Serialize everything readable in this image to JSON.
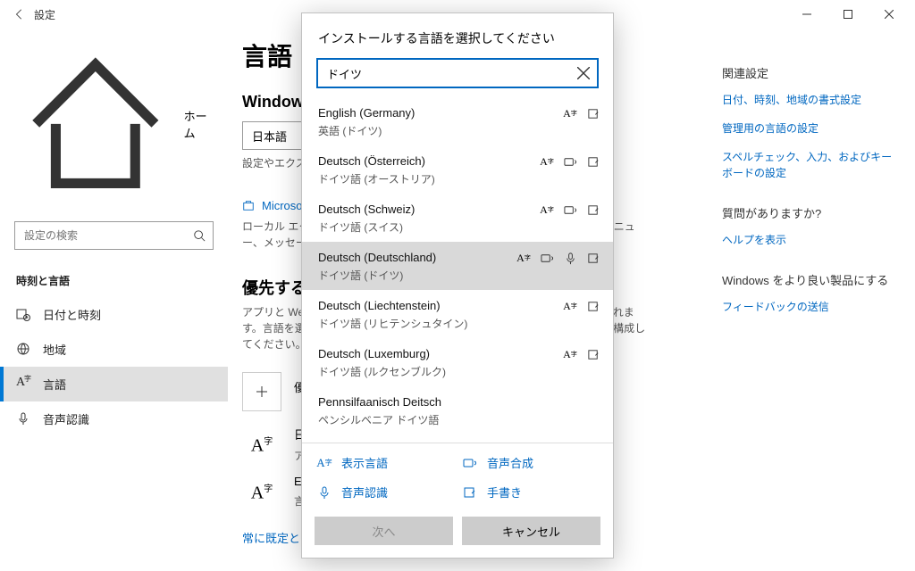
{
  "window": {
    "title": "設定"
  },
  "sidebar": {
    "home": "ホーム",
    "search_placeholder": "設定の検索",
    "heading": "時刻と言語",
    "items": [
      {
        "label": "日付と時刻"
      },
      {
        "label": "地域"
      },
      {
        "label": "言語"
      },
      {
        "label": "音声認識"
      }
    ]
  },
  "page": {
    "title": "言語",
    "display_heading": "Windows の表示言語",
    "display_value": "日本語",
    "display_note": "設定やエクスプローラーなどの Windows 機能は、この言語で表示されます。",
    "ms_link": "Microsoft Store で Windows の表示言語を追加する",
    "local_note": "ローカル エクスペリエンス パックを使うと、Windows のナビゲーション、メニュー、メッセージ、設定、ヘルプ トピックで使用する言語を変更できます。",
    "pref_heading": "優先する言語",
    "pref_note": "アプリと Web サイトは、一覧の中でサポートされている最初の言語で表示されます。言語を選んでから、[オプション] を選んで、キーボードやその他の機能を構成してください。",
    "add_label": "優先する言語を追加する",
    "jp_name": "日本語",
    "jp_sub": "アプリの既定の言語、Windows の表示言語",
    "en_name": "English (United States)",
    "en_sub": "言語パックをインストールしました",
    "default_link": "常に既定として使用する入力方式を選択する"
  },
  "right": {
    "related": "関連設定",
    "link1": "日付、時刻、地域の書式設定",
    "link2": "管理用の言語の設定",
    "link3": "スペルチェック、入力、およびキーボードの設定",
    "help_heading": "質問がありますか?",
    "help_link": "ヘルプを表示",
    "feedback_heading": "Windows をより良い製品にする",
    "feedback_link": "フィードバックの送信"
  },
  "dialog": {
    "title": "インストールする言語を選択してください",
    "search_value": "ドイツ",
    "items": [
      {
        "name": "English (Germany)",
        "sub": "英語 (ドイツ)",
        "icons": [
          "display",
          "hand"
        ]
      },
      {
        "name": "Deutsch (Österreich)",
        "sub": "ドイツ語 (オーストリア)",
        "icons": [
          "display",
          "tts",
          "hand"
        ]
      },
      {
        "name": "Deutsch (Schweiz)",
        "sub": "ドイツ語 (スイス)",
        "icons": [
          "display",
          "tts",
          "hand"
        ]
      },
      {
        "name": "Deutsch (Deutschland)",
        "sub": "ドイツ語 (ドイツ)",
        "icons": [
          "display",
          "tts",
          "sr",
          "hand"
        ],
        "selected": true
      },
      {
        "name": "Deutsch (Liechtenstein)",
        "sub": "ドイツ語 (リヒテンシュタイン)",
        "icons": [
          "display",
          "hand"
        ]
      },
      {
        "name": "Deutsch (Luxemburg)",
        "sub": "ドイツ語 (ルクセンブルク)",
        "icons": [
          "display",
          "hand"
        ]
      },
      {
        "name": "Pennsilfaanisch Deitsch",
        "sub": "ペンシルベニア ドイツ語",
        "icons": []
      }
    ],
    "legend": {
      "display": "表示言語",
      "tts": "音声合成",
      "sr": "音声認識",
      "hand": "手書き"
    },
    "next": "次へ",
    "cancel": "キャンセル"
  }
}
